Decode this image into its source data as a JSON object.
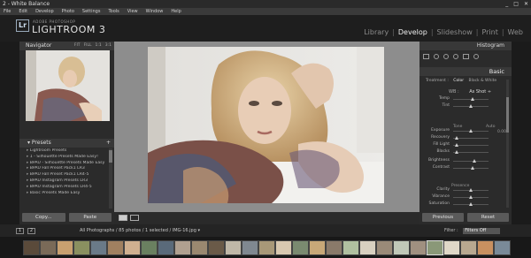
{
  "window": {
    "title": "2 - White Balance",
    "controls": [
      "_",
      "□",
      "✕"
    ]
  },
  "menu": [
    "File",
    "Edit",
    "Develop",
    "Photo",
    "Settings",
    "Tools",
    "View",
    "Window",
    "Help"
  ],
  "identity": {
    "logo": "Lr",
    "small": "ADOBE PHOTOSHOP",
    "big": "LIGHTROOM 3"
  },
  "modules": [
    "Library",
    "Develop",
    "Slideshow",
    "Print",
    "Web"
  ],
  "active_module": "Develop",
  "navigator": {
    "title": "Navigator",
    "modes": [
      "FIT",
      "FILL",
      "1:1",
      "3:1"
    ]
  },
  "presets": {
    "title": "Presets",
    "plus": "+",
    "items": [
      "Lightroom Presets",
      "1 - Silhouette Presets Made Easy!",
      "BPAU - Silhouette Presets Made Easy",
      "BPAU Fall Preset Pack1 LR3",
      "BPAU Fall Preset Pack1 LR4-5",
      "BPAU Instagram Presets LR3",
      "BPAU Instagram Presets LR4-5",
      "Basic Presets Made Easy"
    ]
  },
  "left_buttons": {
    "copy": "Copy...",
    "paste": "Paste"
  },
  "right_buttons": {
    "previous": "Previous",
    "reset": "Reset"
  },
  "histogram": {
    "title": "Histogram"
  },
  "basic": {
    "title": "Basic",
    "treatment_label": "Treatment :",
    "treatment_color": "Color",
    "treatment_bw": "Black & White",
    "wb_label": "WB :",
    "wb_value": "As Shot ÷",
    "tone_label": "Tone",
    "auto_label": "Auto",
    "presence_label": "Presence",
    "sliders": [
      {
        "label": "Temp",
        "section": "wb",
        "value": 0.55
      },
      {
        "label": "Tint",
        "section": "wb",
        "value": 0.5
      },
      {
        "label": "Exposure",
        "section": "tone",
        "value": 0.5,
        "readout": "0.00"
      },
      {
        "label": "Recovery",
        "section": "tone",
        "value": 0.1
      },
      {
        "label": "Fill Light",
        "section": "tone",
        "value": 0.1
      },
      {
        "label": "Blacks",
        "section": "tone",
        "value": 0.12
      },
      {
        "label": "Brightness",
        "section": "tone2",
        "value": 0.6
      },
      {
        "label": "Contrast",
        "section": "tone2",
        "value": 0.55
      },
      {
        "label": "Clarity",
        "section": "presence",
        "value": 0.5
      },
      {
        "label": "Vibrance",
        "section": "presence",
        "value": 0.5
      },
      {
        "label": "Saturation",
        "section": "presence",
        "value": 0.5
      }
    ]
  },
  "filmstrip": {
    "page_nums": [
      "1",
      "2"
    ],
    "path": "All Photographs / 85 photos / 1 selected / IMG-16.jpg ▾",
    "filter_label": "Filter :",
    "filter_value": "Filters Off",
    "thumb_colors": [
      "#5a4a3a",
      "#7a6a58",
      "#c8a070",
      "#8a9060",
      "#6a7a88",
      "#a08060",
      "#d0b090",
      "#6a8060",
      "#5a6a7a",
      "#b0a090",
      "#9a8870",
      "#6a5a48",
      "#c0b8a8",
      "#808890",
      "#a89878",
      "#d8c8b0",
      "#7a8a70",
      "#c8a878",
      "#8a7a6a",
      "#b0c0a0",
      "#d8d0c0",
      "#9a8a78",
      "#c0c8b8",
      "#a09080",
      "#8a9878",
      "#e0d8c8",
      "#b8a890",
      "#c89060",
      "#7a8a98"
    ]
  }
}
